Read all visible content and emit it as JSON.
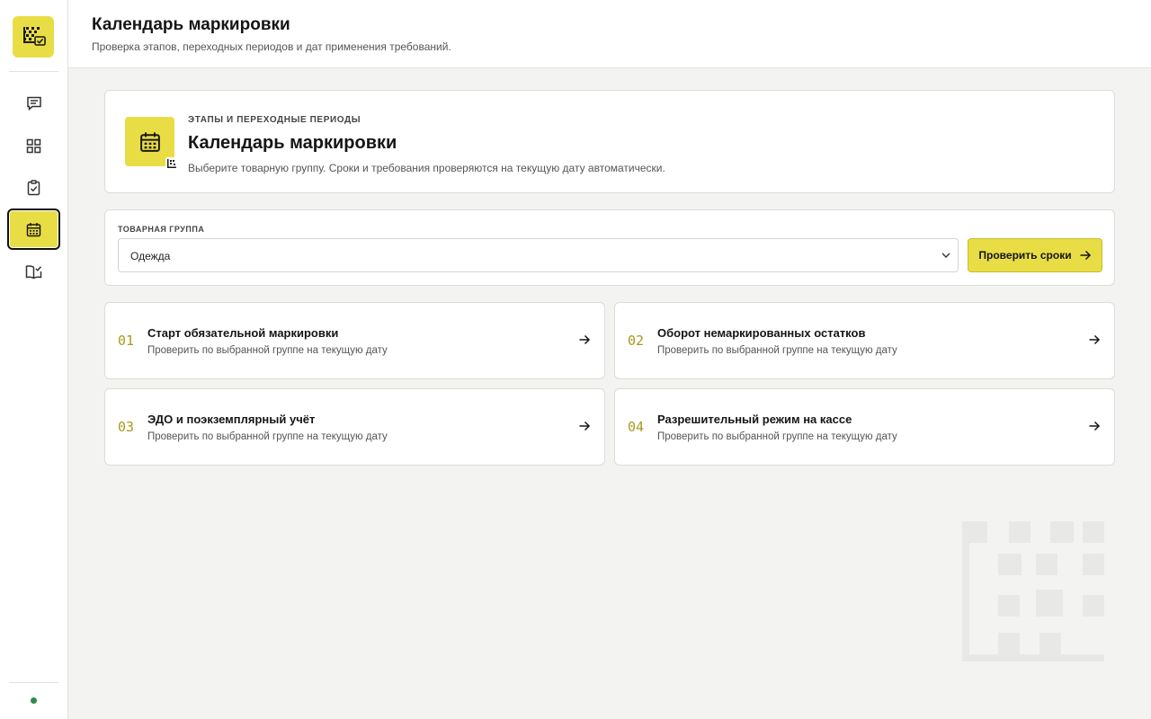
{
  "header": {
    "title": "Календарь маркировки",
    "subtitle": "Проверка этапов, переходных периодов и дат применения требований."
  },
  "sidebar": {
    "logo_icon": "datamatrix-check-icon",
    "items": [
      {
        "icon": "chat-icon",
        "active": false
      },
      {
        "icon": "grid-icon",
        "active": false
      },
      {
        "icon": "clipboard-check-icon",
        "active": false
      },
      {
        "icon": "calendar-icon",
        "active": true
      },
      {
        "icon": "book-check-icon",
        "active": false
      }
    ],
    "status_color": "#2e8b4a"
  },
  "intro": {
    "kicker": "ЭТАПЫ И ПЕРЕХОДНЫЕ ПЕРИОДЫ",
    "title": "Календарь маркировки",
    "description": "Выберите товарную группу. Сроки и требования проверяются на текущую дату автоматически.",
    "icon": "calendar-icon"
  },
  "selector": {
    "label": "ТОВАРНАЯ ГРУППА",
    "value": "Одежда",
    "button_label": "Проверить сроки"
  },
  "steps": [
    {
      "num": "01",
      "title": "Старт обязательной маркировки",
      "desc": "Проверить по выбранной группе на текущую дату"
    },
    {
      "num": "02",
      "title": "Оборот немаркированных остатков",
      "desc": "Проверить по выбранной группе на текущую дату"
    },
    {
      "num": "03",
      "title": "ЭДО и поэкземплярный учёт",
      "desc": "Проверить по выбранной группе на текущую дату"
    },
    {
      "num": "04",
      "title": "Разрешительный режим на кассе",
      "desc": "Проверить по выбранной группе на текущую дату"
    }
  ],
  "colors": {
    "accent": "#e9dd45",
    "step_number": "#a89a1c",
    "background": "#f3f3f1"
  }
}
